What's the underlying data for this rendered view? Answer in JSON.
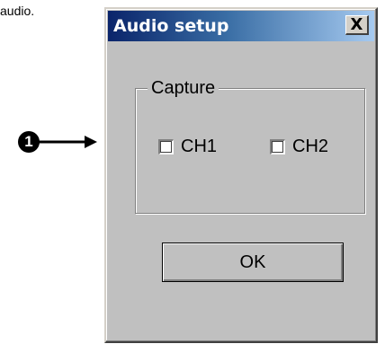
{
  "document": {
    "text": "audio."
  },
  "callout": {
    "number": "1"
  },
  "dialog": {
    "title": "Audio setup",
    "close_label": "X",
    "group": {
      "label": "Capture",
      "checkboxes": [
        {
          "label": "CH1",
          "checked": false
        },
        {
          "label": "CH2",
          "checked": false
        }
      ]
    },
    "ok_label": "OK"
  }
}
